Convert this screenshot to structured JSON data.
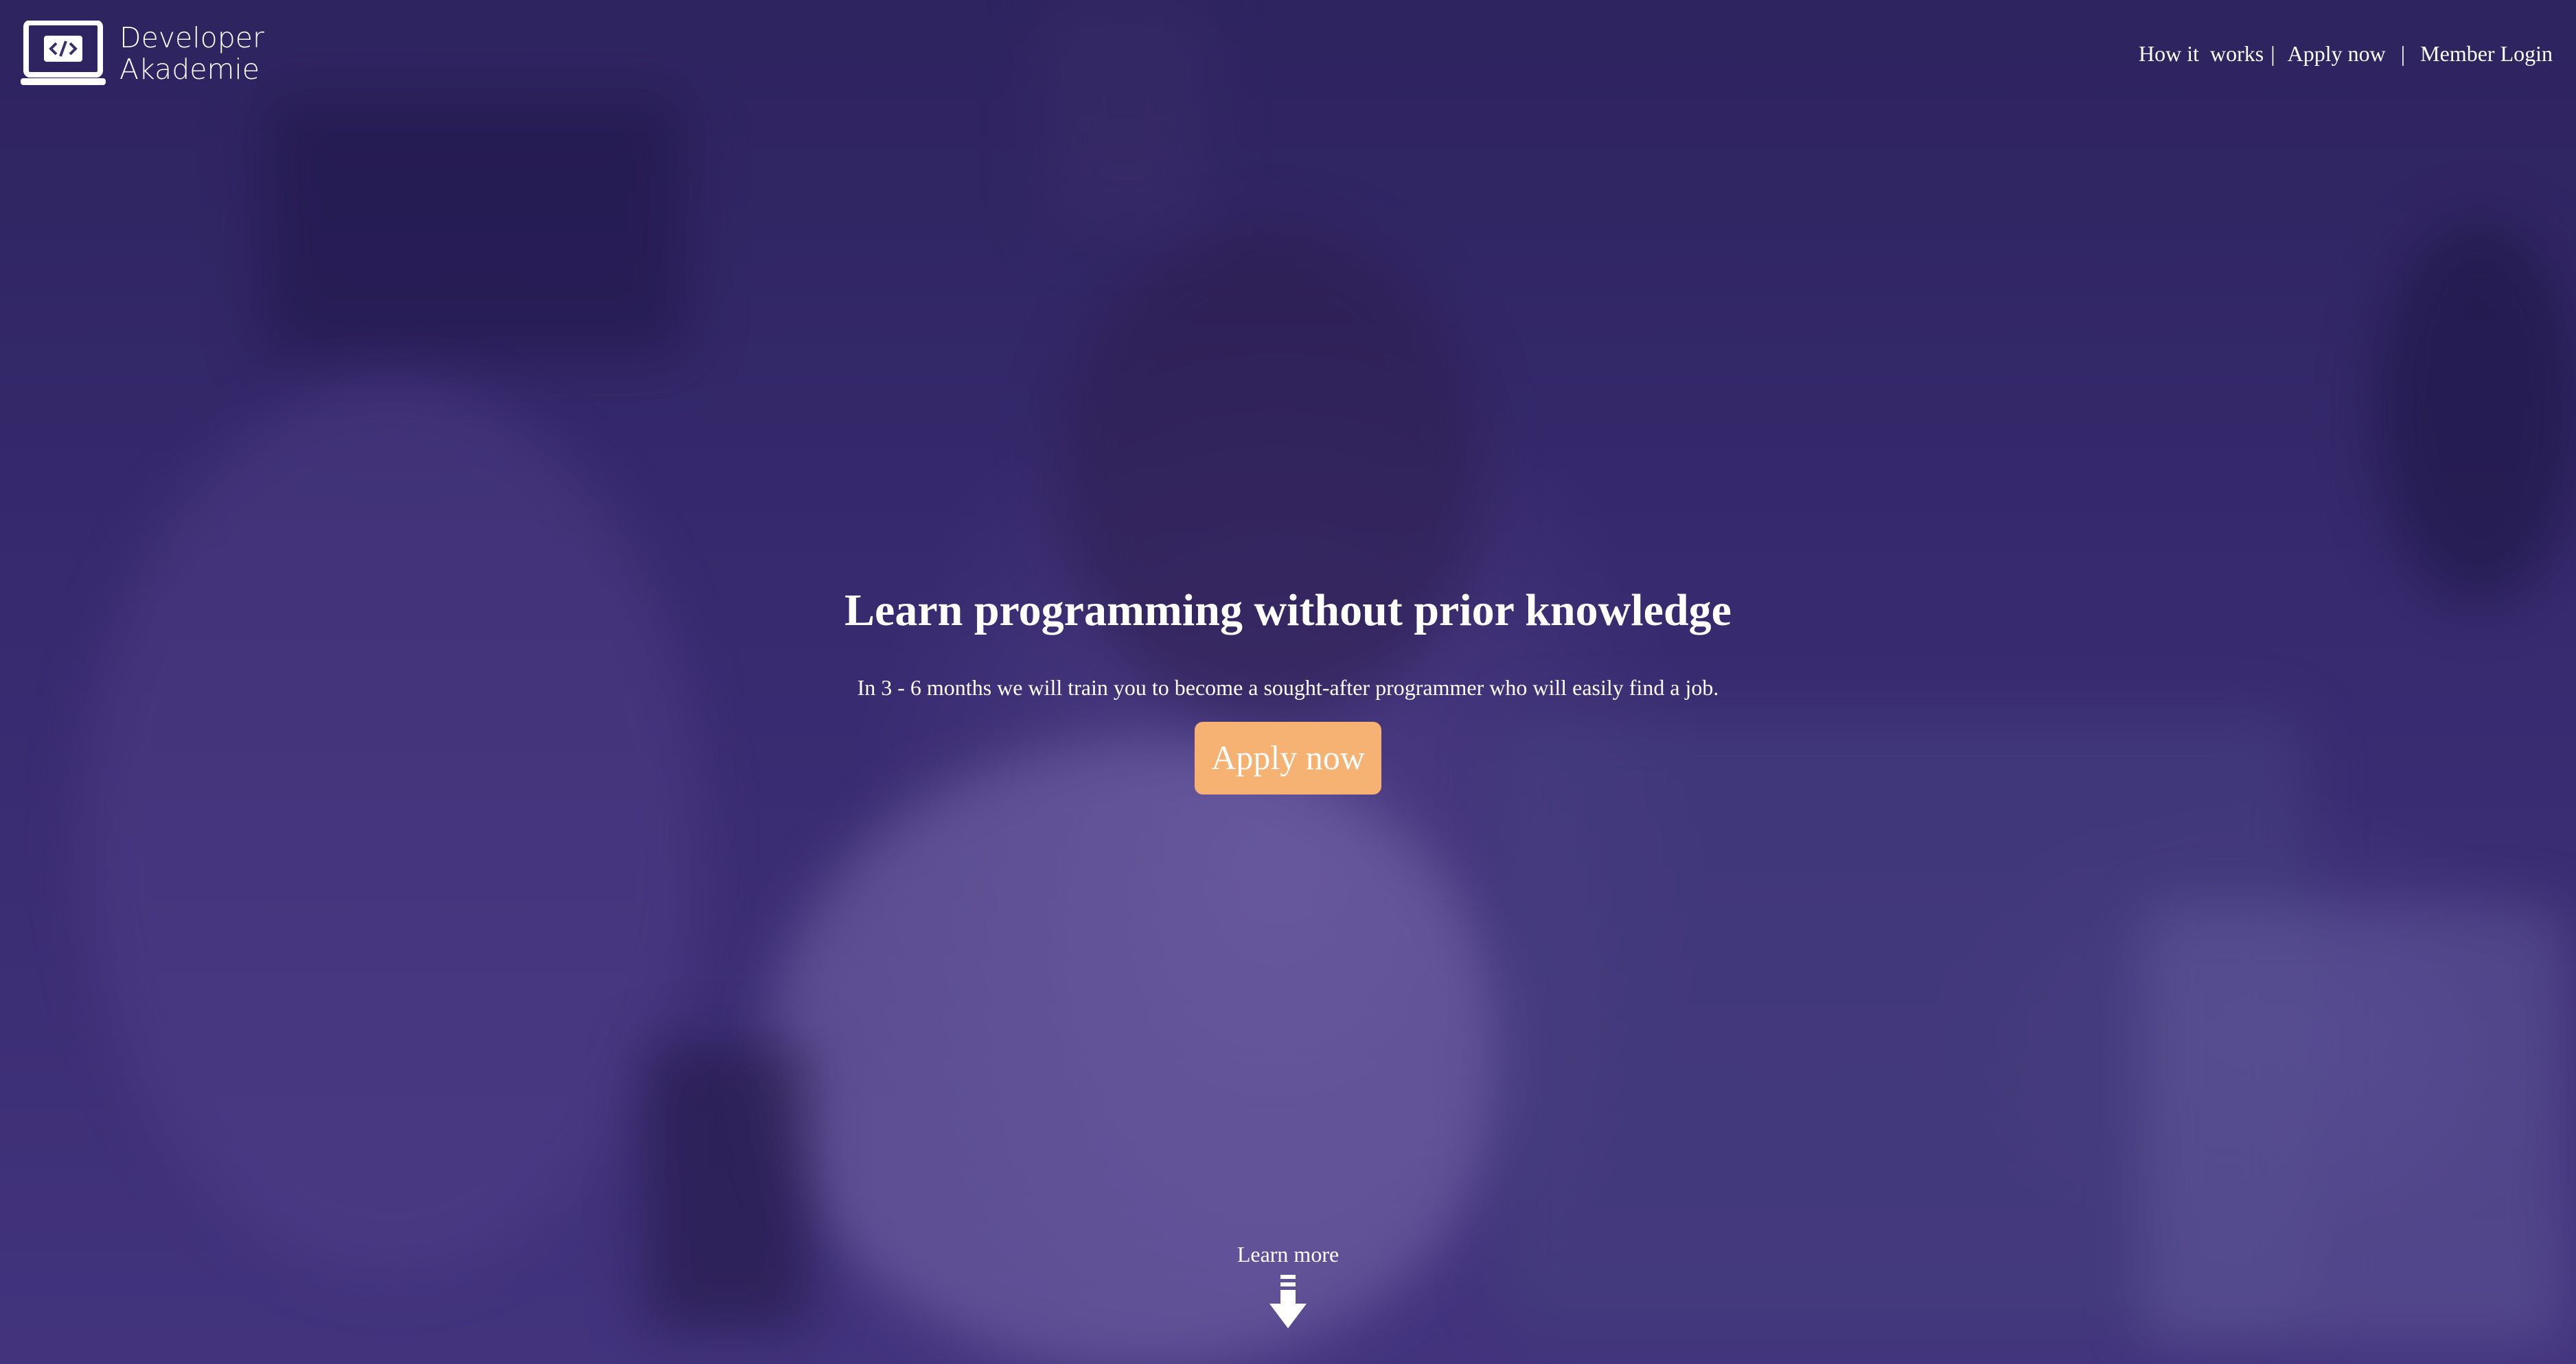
{
  "header": {
    "logo_line1": "Developer",
    "logo_line2": "Akademie",
    "logo_icon": "laptop-code-icon"
  },
  "nav": {
    "items": [
      {
        "label": "How it  works"
      },
      {
        "label": "Apply now"
      },
      {
        "label": "Member Login"
      }
    ],
    "separator": "|"
  },
  "hero": {
    "title": "Learn programming without prior knowledge",
    "subtitle": "In 3 - 6 months we will train you to become a sought-after programmer who will easily find a job.",
    "cta_label": "Apply now",
    "learn_more_label": "Learn more",
    "learn_more_icon": "arrow-down-icon"
  },
  "colors": {
    "overlay": "#3f2a8a",
    "cta_background": "#f6b272",
    "text": "#ffffff"
  }
}
